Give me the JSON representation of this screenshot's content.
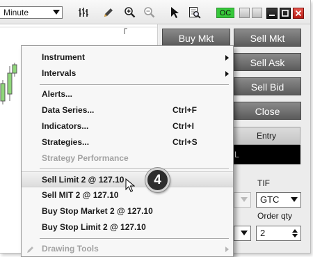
{
  "toolbar": {
    "interval_value": "Minute",
    "icons": [
      "bar-type-icon",
      "pencil-icon",
      "zoom-in-icon",
      "zoom-out-icon",
      "pointer-icon",
      "find-icon"
    ],
    "oc_label": "OC"
  },
  "order_panel": {
    "buy_mkt": "Buy Mkt",
    "sell_mkt": "Sell Mkt",
    "sell_ask": "Sell Ask",
    "sell_bid": "Sell Bid",
    "close": "Close",
    "entry_header": "Entry",
    "entry_value": "L",
    "tif_label": "TIF",
    "tif_value": "GTC",
    "order_qty_label": "Order qty",
    "order_qty_value": "2"
  },
  "context_menu": {
    "items": [
      {
        "label": "Instrument",
        "submenu": true
      },
      {
        "label": "Intervals",
        "submenu": true
      },
      {
        "label": "Alerts..."
      },
      {
        "label": "Data Series...",
        "shortcut": "Ctrl+F"
      },
      {
        "label": "Indicators...",
        "shortcut": "Ctrl+I"
      },
      {
        "label": "Strategies...",
        "shortcut": "Ctrl+S"
      },
      {
        "label": "Strategy Performance",
        "disabled": true
      },
      {
        "label": "Sell Limit 2 @ 127.10",
        "highlighted": true
      },
      {
        "label": "Sell MIT 2 @ 127.10"
      },
      {
        "label": "Buy Stop Market 2 @ 127.10"
      },
      {
        "label": "Buy Stop Limit 2 @ 127.10"
      },
      {
        "label": "Drawing Tools",
        "submenu": true,
        "disabled": true
      }
    ]
  },
  "step_badge": "4",
  "colors": {
    "oc_green": "#36c83a",
    "close_red": "#c9231b",
    "panel_button": "#6f6f6f",
    "candle_green": "#8fd67a"
  }
}
